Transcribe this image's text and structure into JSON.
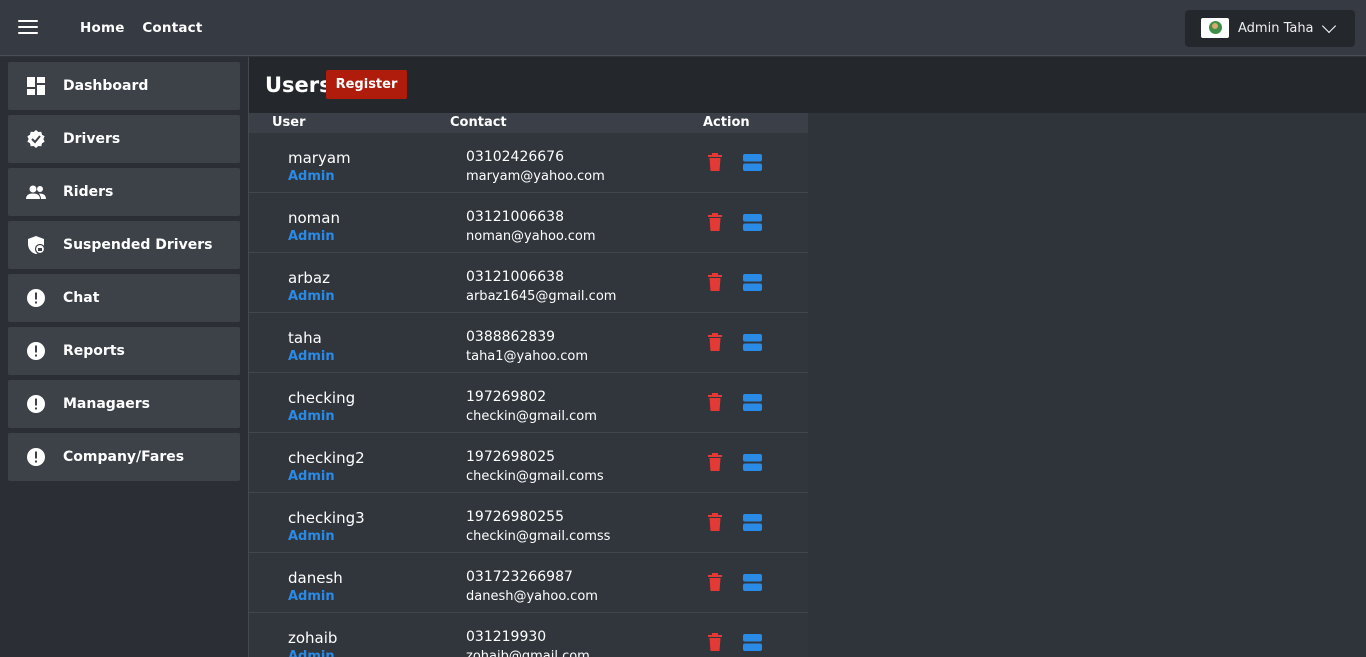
{
  "topbar": {
    "nav": [
      "Home",
      "Contact"
    ],
    "user": {
      "name": "Admin Taha"
    }
  },
  "sidebar": {
    "items": [
      {
        "label": "Dashboard",
        "icon": "dashboard-icon"
      },
      {
        "label": "Drivers",
        "icon": "verified-badge-icon"
      },
      {
        "label": "Riders",
        "icon": "people-icon"
      },
      {
        "label": "Suspended Drivers",
        "icon": "shield-lock-icon"
      },
      {
        "label": "Chat",
        "icon": "alert-circle-icon"
      },
      {
        "label": "Reports",
        "icon": "alert-circle-icon"
      },
      {
        "label": "Managaers",
        "icon": "alert-circle-icon"
      },
      {
        "label": "Company/Fares",
        "icon": "alert-circle-icon"
      }
    ]
  },
  "page": {
    "title": "Users",
    "register_label": "Register"
  },
  "table": {
    "headers": {
      "user": "User",
      "contact": "Contact",
      "action": "Action"
    },
    "rows": [
      {
        "name": "maryam",
        "role": "Admin",
        "phone": "03102426676",
        "email": "maryam@yahoo.com"
      },
      {
        "name": "noman",
        "role": "Admin",
        "phone": "03121006638",
        "email": "noman@yahoo.com"
      },
      {
        "name": "arbaz",
        "role": "Admin",
        "phone": "03121006638",
        "email": "arbaz1645@gmail.com"
      },
      {
        "name": "taha",
        "role": "Admin",
        "phone": "0388862839",
        "email": "taha1@yahoo.com"
      },
      {
        "name": "checking",
        "role": "Admin",
        "phone": "197269802",
        "email": "checkin@gmail.com"
      },
      {
        "name": "checking2",
        "role": "Admin",
        "phone": "1972698025",
        "email": "checkin@gmail.coms"
      },
      {
        "name": "checking3",
        "role": "Admin",
        "phone": "19726980255",
        "email": "checkin@gmail.comss"
      },
      {
        "name": "danesh",
        "role": "Admin",
        "phone": "031723266987",
        "email": "danesh@yahoo.com"
      },
      {
        "name": "zohaib",
        "role": "Admin",
        "phone": "031219930",
        "email": "zohaib@gmail.com"
      }
    ]
  },
  "colors": {
    "accent_blue": "#2a8be6",
    "danger_red": "#e53935",
    "register_red": "#b01c0c"
  }
}
